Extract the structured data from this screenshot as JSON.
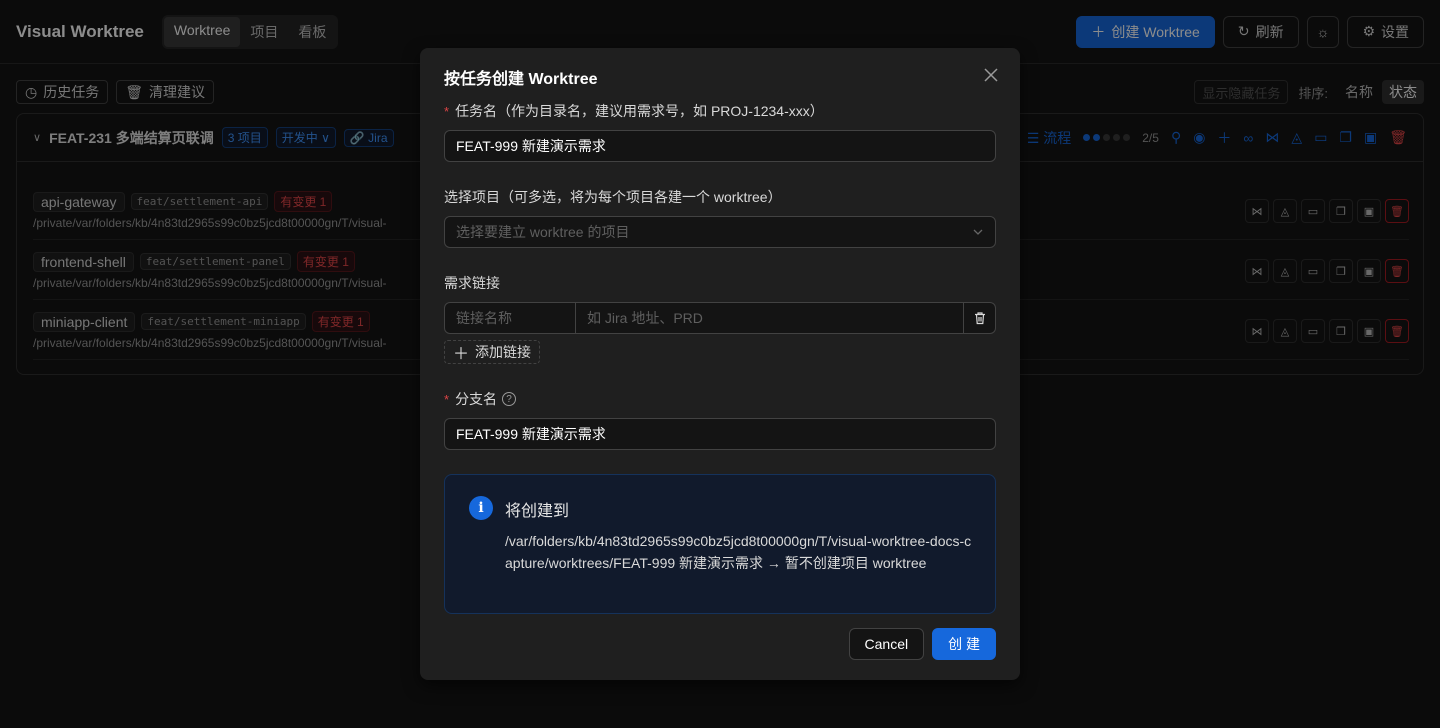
{
  "app": {
    "brand": "Visual Worktree",
    "nav_tabs": [
      {
        "label": "Worktree",
        "active": true
      },
      {
        "label": "项目",
        "active": false
      },
      {
        "label": "看板",
        "active": false
      }
    ],
    "actions": {
      "create_label": "创建 Worktree",
      "refresh_label": "刷新",
      "settings_label": "设置"
    },
    "toolbar": {
      "history_label": "历史任务",
      "cleanup_label": "清理建议",
      "show_hidden_label": "显示隐藏任务",
      "sort_label": "排序:",
      "sort_options": [
        {
          "label": "名称",
          "active": false
        },
        {
          "label": "状态",
          "active": true
        }
      ]
    },
    "task_card": {
      "title": "FEAT-231 多端结算页联调",
      "project_count": "3 项目",
      "status": "开发中",
      "jira_label": "Jira",
      "flow_label": "流程",
      "progress_text": "2/5",
      "progress_steps_done": 2,
      "progress_steps_total": 5,
      "rows": [
        {
          "project": "api-gateway",
          "branch": "feat/settlement-api",
          "change": "有变更 1",
          "path": "/private/var/folders/kb/4n83td2965s99c0bz5jcd8t00000gn/T/visual-"
        },
        {
          "project": "frontend-shell",
          "branch": "feat/settlement-panel",
          "change": "有变更 1",
          "path": "/private/var/folders/kb/4n83td2965s99c0bz5jcd8t00000gn/T/visual-"
        },
        {
          "project": "miniapp-client",
          "branch": "feat/settlement-miniapp",
          "change": "有变更 1",
          "path": "/private/var/folders/kb/4n83td2965s99c0bz5jcd8t00000gn/T/visual-"
        }
      ]
    }
  },
  "modal": {
    "title": "按任务创建 Worktree",
    "task_name": {
      "label": "任务名（作为目录名，建议用需求号，如 PROJ-1234-xxx）",
      "value": "FEAT-999 新建演示需求"
    },
    "projects": {
      "label": "选择项目（可多选，将为每个项目各建一个 worktree）",
      "placeholder": "选择要建立 worktree 的项目"
    },
    "links": {
      "label": "需求链接",
      "name_placeholder": "链接名称",
      "url_placeholder": "如 Jira 地址、PRD",
      "add_label": "添加链接"
    },
    "branch": {
      "label": "分支名",
      "value": "FEAT-999 新建演示需求"
    },
    "info": {
      "title": "将创建到",
      "description": "/var/folders/kb/4n83td2965s99c0bz5jcd8t00000gn/T/visual-worktree-docs-capture/worktrees/FEAT-999 新建演示需求 → 暂不创建项目 worktree"
    },
    "cancel_label": "Cancel",
    "confirm_label": "创 建"
  },
  "colors": {
    "primary": "#1668dc",
    "danger": "#e84749",
    "modal_bg": "#1f1f1f",
    "info_bg": "#111a2c"
  }
}
